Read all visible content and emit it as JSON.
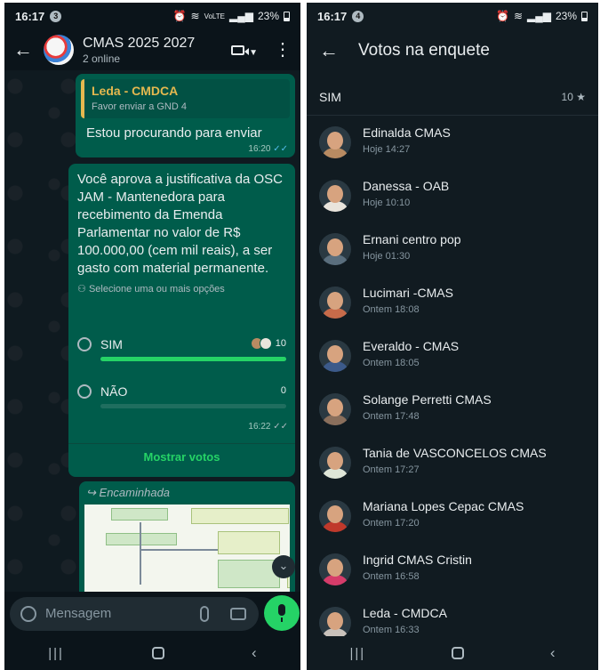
{
  "left": {
    "status": {
      "time": "16:17",
      "notif": "3",
      "battery": "23%",
      "signal": "VoLTE"
    },
    "header": {
      "title": "CMAS 2025 2027",
      "subtitle": "2 online"
    },
    "quoted_message": {
      "author": "Leda - CMDCA",
      "quoted_text": "Favor enviar a GND 4",
      "text": "Estou procurando para enviar",
      "time": "16:20",
      "ticks": "✓✓"
    },
    "poll": {
      "question": "Você aprova a justificativa da OSC JAM - Mantenedora para recebimento da Emenda Parlamentar  no valor de R$ 100.000,00 (cem mil reais), a ser gasto com material permanente.",
      "hint": "Selecione uma ou mais opções",
      "options": [
        {
          "label": "SIM",
          "count": "10",
          "fraction": 1.0
        },
        {
          "label": "NÃO",
          "count": "0",
          "fraction": 0.0
        }
      ],
      "time": "16:22",
      "ticks": "✓✓",
      "see_votes": "Mostrar votos"
    },
    "forwarded": {
      "label": "Encaminhada"
    },
    "composer": {
      "placeholder": "Mensagem"
    }
  },
  "right": {
    "status": {
      "time": "16:17",
      "notif": "4",
      "battery": "23%"
    },
    "title": "Votos na enquete",
    "option": {
      "name": "SIM",
      "count": "10 ★"
    },
    "voters": [
      {
        "name": "Edinalda CMAS",
        "when": "Hoje 14:27",
        "color": "#b88b62"
      },
      {
        "name": "Danessa - OAB",
        "when": "Hoje 10:10",
        "color": "#e9e4dc"
      },
      {
        "name": "Ernani centro pop",
        "when": "Hoje 01:30",
        "color": "#5a6e7d"
      },
      {
        "name": "Lucimari -CMAS",
        "when": "Ontem 18:08",
        "color": "#c76b4a"
      },
      {
        "name": "Everaldo - CMAS",
        "when": "Ontem 18:05",
        "color": "#3c5a8a"
      },
      {
        "name": "Solange Perretti CMAS",
        "when": "Ontem 17:48",
        "color": "#8a6f5c"
      },
      {
        "name": "Tania de VASCONCELOS CMAS",
        "when": "Ontem 17:27",
        "color": "#dfe6d8"
      },
      {
        "name": "Mariana Lopes Cepac CMAS",
        "when": "Ontem 17:20",
        "color": "#c0392b"
      },
      {
        "name": "Ingrid CMAS Cristin",
        "when": "Ontem 16:58",
        "color": "#d63c6a"
      },
      {
        "name": "Leda - CMDCA",
        "when": "Ontem 16:33",
        "color": "#c9c2bb"
      }
    ]
  }
}
